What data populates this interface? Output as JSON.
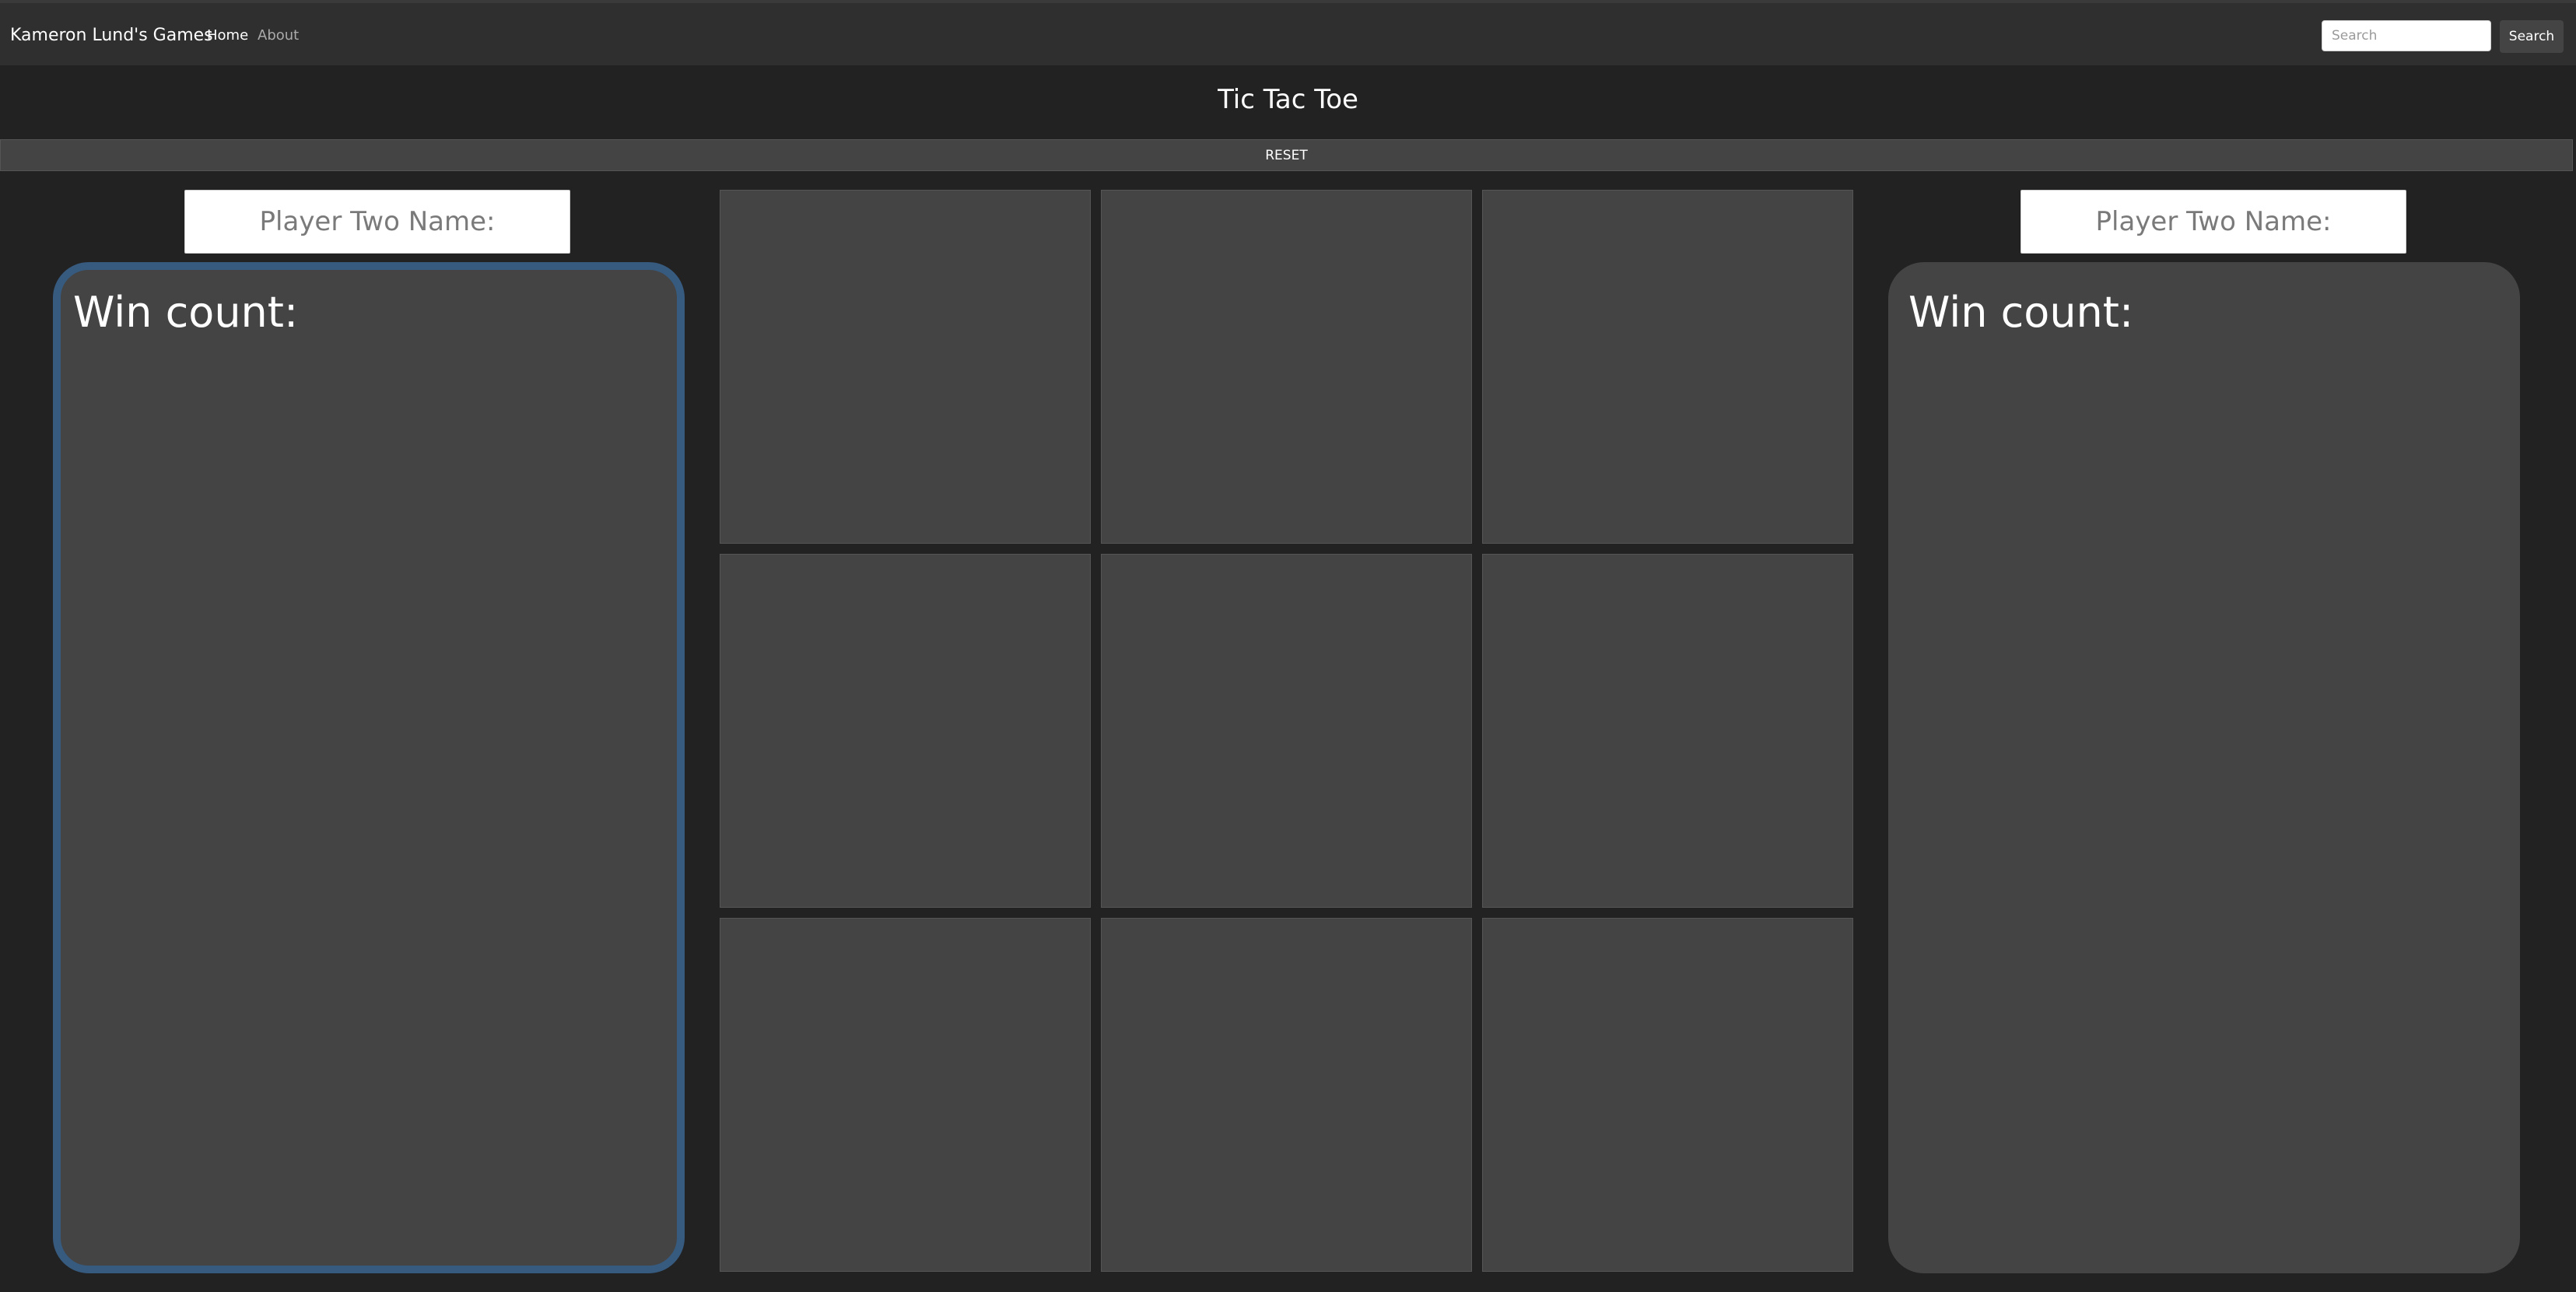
{
  "navbar": {
    "brand": "Kameron Lund's Games",
    "links": [
      "Home",
      "About"
    ],
    "search": {
      "placeholder": "Search",
      "value": "",
      "button_label": "Search"
    }
  },
  "game": {
    "title": "Tic Tac Toe",
    "reset_label": "RESET",
    "board": [
      "",
      "",
      "",
      "",
      "",
      "",
      "",
      "",
      ""
    ]
  },
  "players": {
    "left": {
      "name_placeholder": "Player Two Name:",
      "name_value": "",
      "win_label": "Win count:",
      "active": true
    },
    "right": {
      "name_placeholder": "Player Two Name:",
      "name_value": "",
      "win_label": "Win count:",
      "active": false
    }
  },
  "colors": {
    "background": "#222222",
    "navbar": "#2f2f2f",
    "panel": "#444444",
    "active_border": "#375a7f"
  }
}
